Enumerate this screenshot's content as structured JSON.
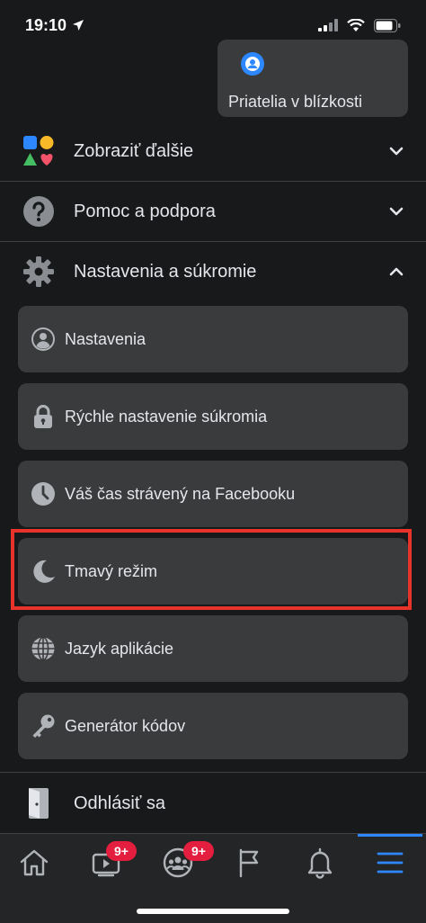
{
  "status": {
    "time": "19:10"
  },
  "nearby": {
    "label": "Priatelia v blízkosti"
  },
  "sections": {
    "more": {
      "label": "Zobraziť ďalšie"
    },
    "help": {
      "label": "Pomoc a podpora"
    },
    "settings": {
      "label": "Nastavenia a súkromie"
    },
    "logout": {
      "label": "Odhlásiť sa"
    }
  },
  "settings_items": [
    {
      "label": "Nastavenia",
      "icon": "person-circle-icon"
    },
    {
      "label": "Rýchle nastavenie súkromia",
      "icon": "lock-icon"
    },
    {
      "label": "Váš čas strávený na Facebooku",
      "icon": "clock-icon"
    },
    {
      "label": "Tmavý režim",
      "icon": "moon-icon"
    },
    {
      "label": "Jazyk aplikácie",
      "icon": "globe-icon"
    },
    {
      "label": "Generátor kódov",
      "icon": "key-icon"
    }
  ],
  "nav": {
    "watch_badge": "9+",
    "groups_badge": "9+"
  },
  "colors": {
    "background": "#18191a",
    "card": "#3a3b3c",
    "accent": "#2d88ff",
    "badge": "#e41e3f",
    "highlight": "#e8332b"
  }
}
